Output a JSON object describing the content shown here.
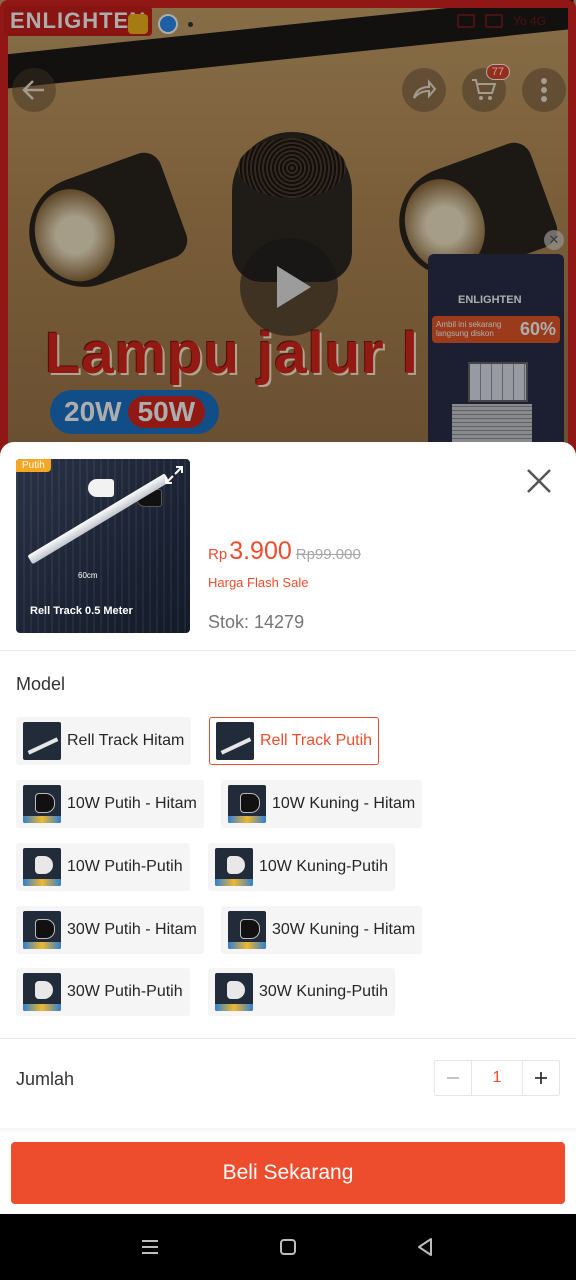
{
  "background": {
    "brand_logo": "ENLIGHTEN",
    "headline": "Lampu jalur l",
    "watt_options": [
      "20W",
      "50W"
    ],
    "cart_count": "77",
    "promo": {
      "logo": "ENLIGHTEN",
      "subtext": "Ambil ini sekarang langsung diskon",
      "discount": "60%"
    },
    "status_text": "Yo 4G"
  },
  "sheet": {
    "thumbnail": {
      "tag": "Putih",
      "caption": "Rell Track 0.5 Meter",
      "dimension": "60cm"
    },
    "price": {
      "currency": "Rp",
      "value": "3.900",
      "original": "Rp99.000"
    },
    "flash_label": "Harga Flash Sale",
    "stock": "Stok: 14279",
    "model_title": "Model",
    "options": [
      {
        "label": "Rell Track Hitam",
        "icon": "rail-black-thumb",
        "selected": false
      },
      {
        "label": "Rell Track Putih",
        "icon": "rail-white-thumb",
        "selected": true
      },
      {
        "label": "10W Putih - Hitam",
        "icon": "lamp-black-thumb",
        "selected": false
      },
      {
        "label": "10W Kuning - Hitam",
        "icon": "lamp-black-thumb",
        "selected": false
      },
      {
        "label": "10W Putih-Putih",
        "icon": "lamp-white-thumb",
        "selected": false
      },
      {
        "label": "10W Kuning-Putih",
        "icon": "lamp-white-thumb",
        "selected": false
      },
      {
        "label": "30W Putih - Hitam",
        "icon": "lamp-black-thumb",
        "selected": false
      },
      {
        "label": "30W Kuning - Hitam",
        "icon": "lamp-black-thumb",
        "selected": false
      },
      {
        "label": "30W Putih-Putih",
        "icon": "lamp-white-thumb",
        "selected": false
      },
      {
        "label": "30W Kuning-Putih",
        "icon": "lamp-white-thumb",
        "selected": false
      }
    ],
    "quantity_title": "Jumlah",
    "quantity": "1",
    "buy_button": "Beli Sekarang"
  },
  "colors": {
    "accent": "#ee4d2d",
    "muted_text": "#757575"
  }
}
